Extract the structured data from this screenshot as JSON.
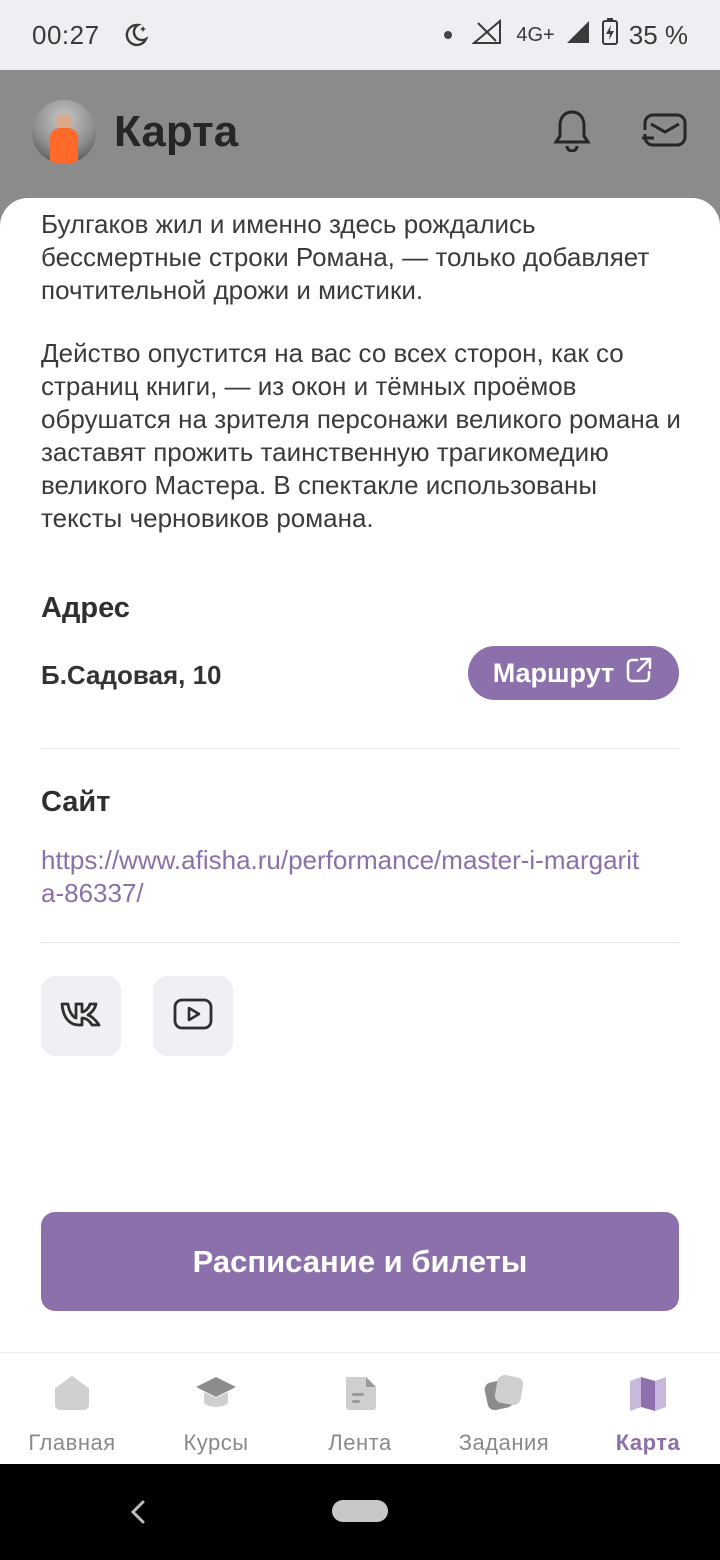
{
  "status_bar": {
    "time": "00:27",
    "network": "4G+",
    "battery": "35 %"
  },
  "header": {
    "title": "Карта",
    "icons": [
      "bell-icon",
      "messages-icon"
    ]
  },
  "description": {
    "paragraph1": "Булгаков жил и именно здесь рождались бессмертные строки Романа, — только добавляет почтительной дрожи и мистики.",
    "paragraph2": "Действо опустится на вас со всех сторон, как со страниц книги, — из окон и тёмных проёмов обрушатся на зрителя персонажи великого романа и заставят прожить таинственную трагикомедию великого Мастера. В спектакле использованы тексты черновиков романа."
  },
  "address": {
    "title": "Адрес",
    "value": "Б.Садовая, 10",
    "route_label": "Маршрут"
  },
  "site": {
    "title": "Сайт",
    "url": "https://www.afisha.ru/performance/master-i-margarita-86337/"
  },
  "social": [
    "vk-icon",
    "youtube-icon"
  ],
  "main_button": "Расписание и билеты",
  "bottom_nav": [
    {
      "label": "Главная",
      "icon": "home-icon",
      "active": false
    },
    {
      "label": "Курсы",
      "icon": "courses-icon",
      "active": false
    },
    {
      "label": "Лента",
      "icon": "feed-icon",
      "active": false
    },
    {
      "label": "Задания",
      "icon": "tasks-icon",
      "active": false
    },
    {
      "label": "Карта",
      "icon": "map-icon",
      "active": true
    }
  ],
  "colors": {
    "accent": "#8b70ab",
    "text": "#3b3b3b",
    "inactive": "#8a8a8a"
  }
}
